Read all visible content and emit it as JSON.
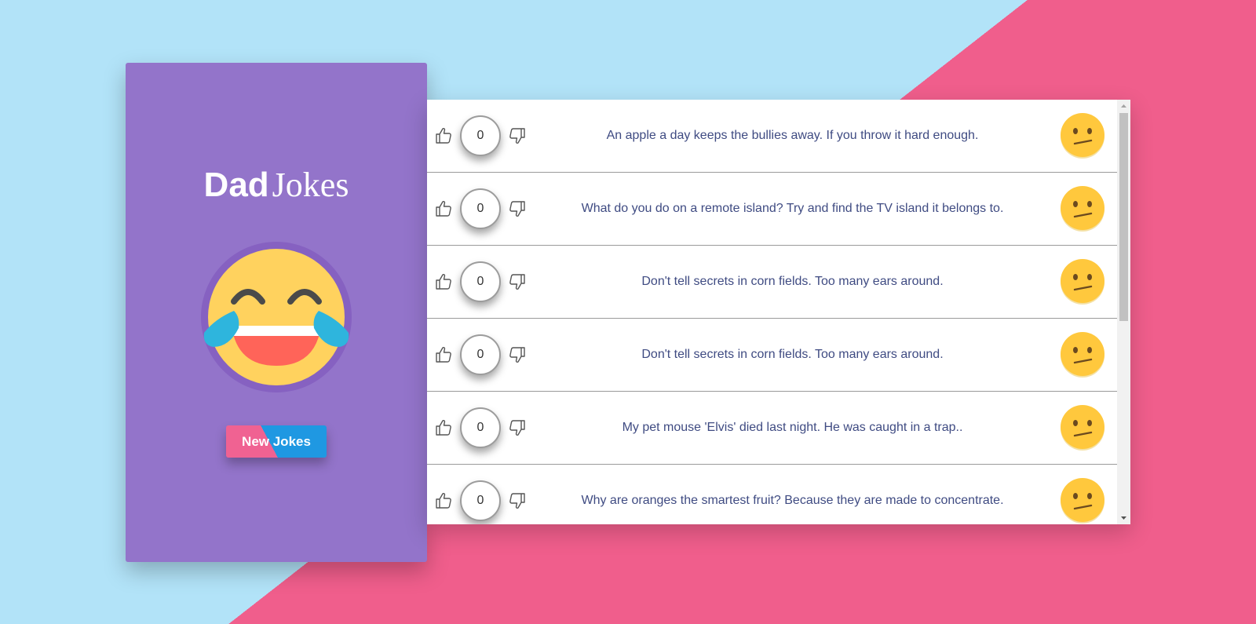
{
  "sidebar": {
    "title_bold": "Dad",
    "title_light": "Jokes",
    "emoji_icon": "laughing-crying-face-icon",
    "button_label": "New Jokes"
  },
  "colors": {
    "sidebar_bg": "#9374ca",
    "background_blue": "#b2e3f8",
    "background_pink": "#f05e8c",
    "button_pink": "#f06292",
    "button_blue": "#1f98e2",
    "joke_text": "#3f4b82",
    "emoji_yellow": "#ffd25e"
  },
  "jokes": [
    {
      "votes": "0",
      "text": "An apple a day keeps the bullies away. If you throw it hard enough.",
      "reaction_icon": "confused-face-icon"
    },
    {
      "votes": "0",
      "text": "What do you do on a remote island? Try and find the TV island it belongs to.",
      "reaction_icon": "confused-face-icon"
    },
    {
      "votes": "0",
      "text": "Don't tell secrets in corn fields. Too many ears around.",
      "reaction_icon": "confused-face-icon"
    },
    {
      "votes": "0",
      "text": "Don't tell secrets in corn fields. Too many ears around.",
      "reaction_icon": "confused-face-icon"
    },
    {
      "votes": "0",
      "text": "My pet mouse 'Elvis' died last night. He was caught in a trap..",
      "reaction_icon": "confused-face-icon"
    },
    {
      "votes": "0",
      "text": "Why are oranges the smartest fruit? Because they are made to concentrate.",
      "reaction_icon": "confused-face-icon"
    }
  ]
}
